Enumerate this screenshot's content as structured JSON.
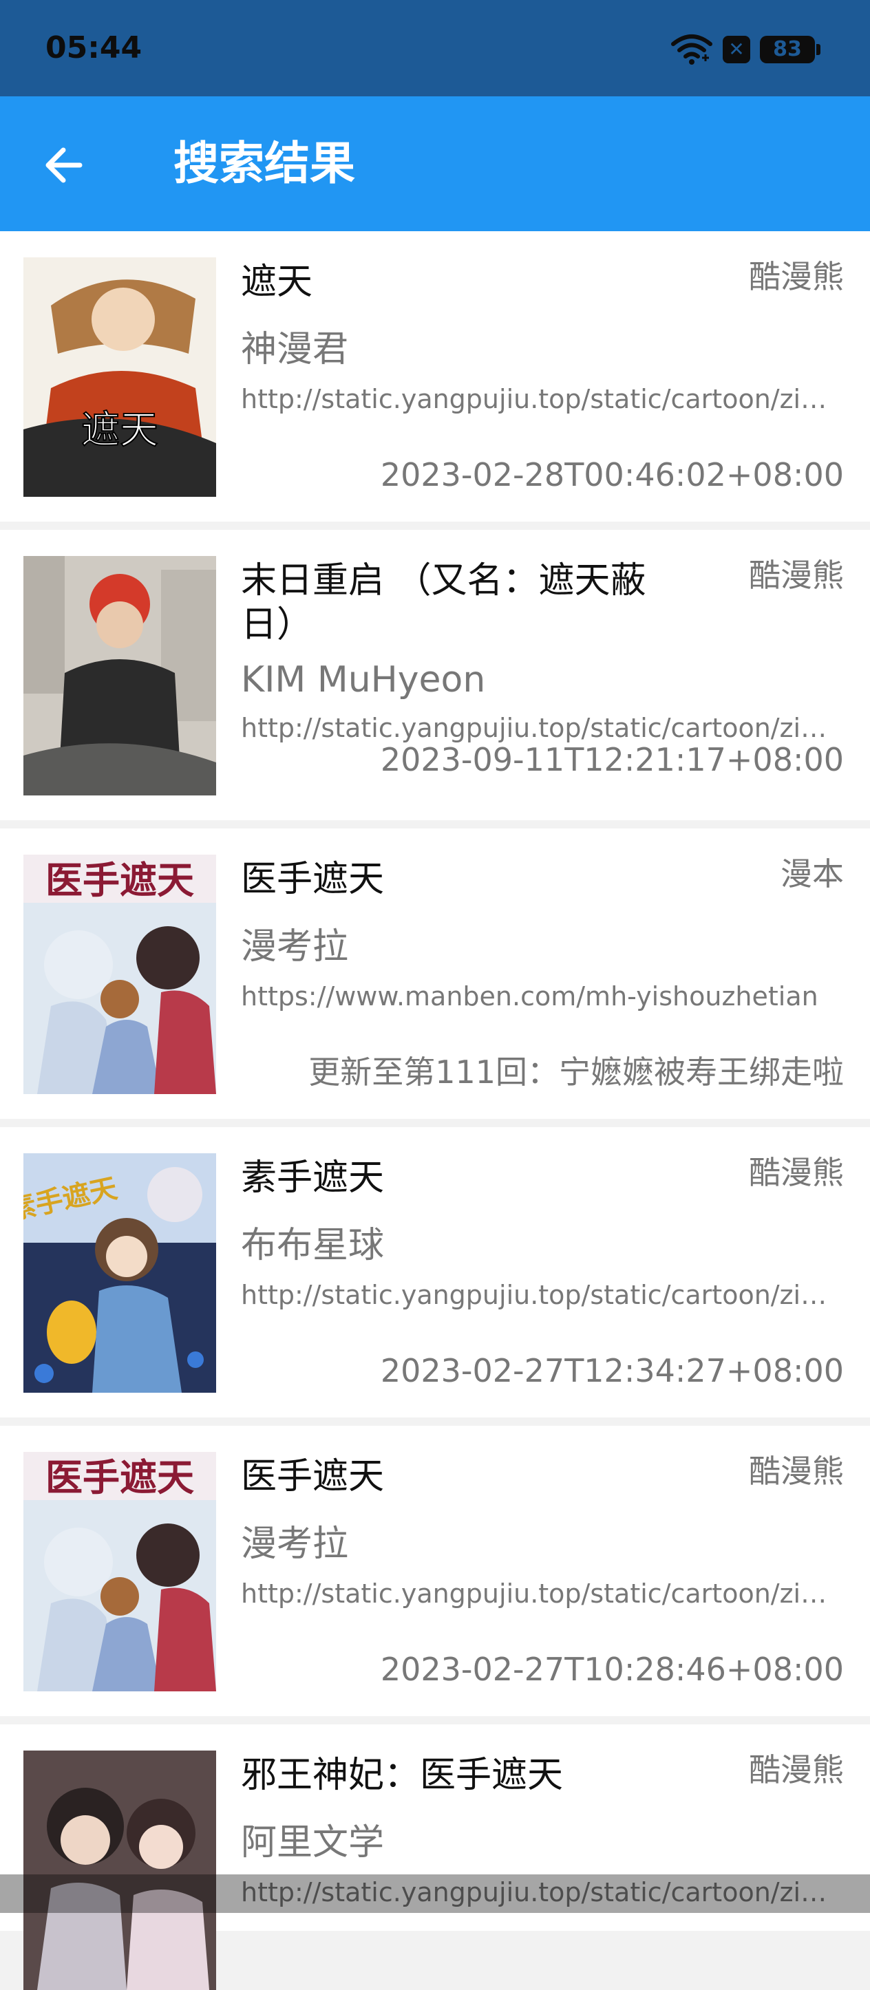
{
  "status_bar": {
    "time": "05:44",
    "battery": "83"
  },
  "app_bar": {
    "title": "搜索结果"
  },
  "results": [
    {
      "title": "遮天",
      "source": "酷漫熊",
      "author": "神漫君",
      "url": "http://static.yangpujiu.top/static/cartoon/zip/...",
      "date": "2023-02-28T00:46:02+08:00",
      "cover_text": "遮天"
    },
    {
      "title": "末日重启 （又名：遮天蔽日）",
      "source": "酷漫熊",
      "author": "KIM MuHyeon",
      "url": "http://static.yangpujiu.top/static/cartoon/zip/...",
      "date": "2023-09-11T12:21:17+08:00"
    },
    {
      "title": "医手遮天",
      "source": "漫本",
      "author": "漫考拉",
      "url": "https://www.manben.com/mh-yishouzhetian",
      "date": "更新至第111回：宁嬷嬷被寿王绑走啦",
      "cover_text": "医手遮天"
    },
    {
      "title": "素手遮天",
      "source": "酷漫熊",
      "author": "布布星球",
      "url": "http://static.yangpujiu.top/static/cartoon/zip/...",
      "date": "2023-02-27T12:34:27+08:00",
      "cover_text": "素手遮天"
    },
    {
      "title": "医手遮天",
      "source": "酷漫熊",
      "author": "漫考拉",
      "url": "http://static.yangpujiu.top/static/cartoon/zip/...",
      "date": "2023-02-27T10:28:46+08:00",
      "cover_text": "医手遮天"
    },
    {
      "title": "邪王神妃：医手遮天",
      "source": "酷漫熊",
      "author": "阿里文学",
      "url": "http://static.yangpujiu.top/static/cartoon/zip/..."
    }
  ]
}
